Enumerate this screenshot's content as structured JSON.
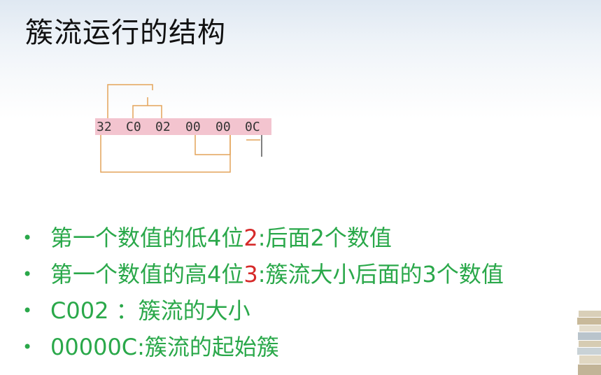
{
  "title": "簇流运行的结构",
  "hex_bytes": [
    "32",
    "C0",
    "02",
    "00",
    "00",
    "0C"
  ],
  "bullets": [
    {
      "pre": "第一个数值的低4位",
      "hl": "2",
      "post": ":后面2个数值"
    },
    {
      "pre": "第一个数值的高4位",
      "hl": "3",
      "post": ":簇流大小后面的3个数值"
    },
    {
      "pre": "C002 ：簇流的大小",
      "hl": "",
      "post": ""
    },
    {
      "pre": "00000C:簇流的起始簇",
      "hl": "",
      "post": ""
    }
  ],
  "colors": {
    "bullet_text": "#2aa84a",
    "highlight": "#d62a2a",
    "hex_bar": "#f3c4cf",
    "connector": "#e4a45a"
  }
}
